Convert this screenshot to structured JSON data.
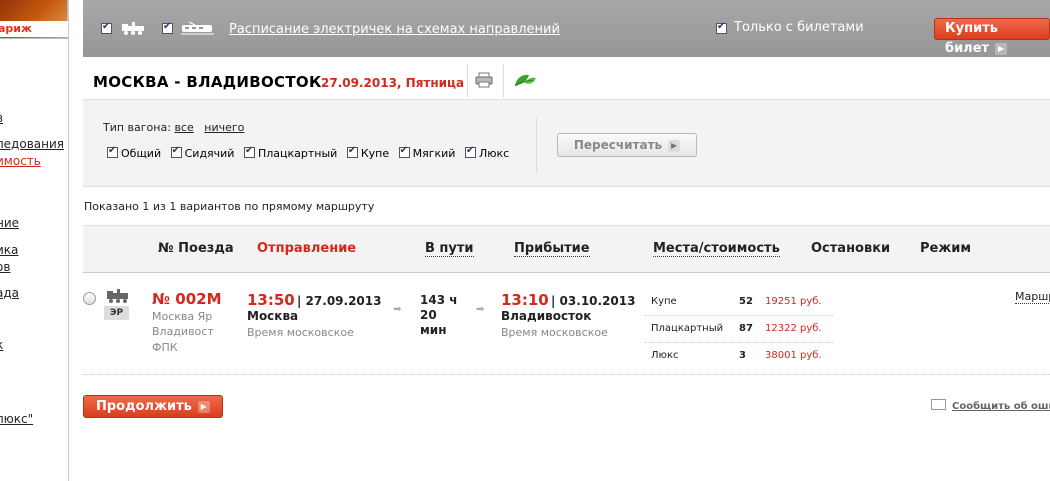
{
  "sidebar": {
    "logo_text": "ариж",
    "links": [
      "в",
      "ледования",
      "имость",
      "ние",
      "ика",
      "ов",
      "ада",
      "к",
      "люкс\""
    ]
  },
  "topbar": {
    "schedule_link": "Расписание электричек на схемах направлений",
    "only_tickets": "Только с билетами",
    "buy_ticket": "Купить билет"
  },
  "route": {
    "title": "МОСКВА - ВЛАДИВОСТОК",
    "date": "27.09.2013, Пятница"
  },
  "filter": {
    "label": "Тип вагона:",
    "all": "все",
    "none": "ничего",
    "wagons": [
      "Общий",
      "Сидячий",
      "Плацкартный",
      "Купе",
      "Мягкий",
      "Люкс"
    ],
    "recalc": "Пересчитать"
  },
  "shown_text": "Показано 1 из 1 вариантов по прямому маршруту",
  "table": {
    "headers": {
      "train_no": "№ Поезда",
      "departure": "Отправление",
      "duration": "В пути",
      "arrival": "Прибытие",
      "seats": "Места/стоимость",
      "stops": "Остановки",
      "mode": "Режим"
    },
    "row": {
      "badge": "ЭР",
      "number": "№ 002М",
      "sub1": "Москва Яр",
      "sub2": "Владивост",
      "sub3": "ФПК",
      "dep_time": "13:50",
      "dep_date": "| 27.09.2013",
      "dep_city": "Москва",
      "dep_tz": "Время московское",
      "dur1": "143 ч",
      "dur2": "20",
      "dur3": "мин",
      "arr_time": "13:10",
      "arr_date": "| 03.10.2013",
      "arr_city": "Владивосток",
      "arr_tz": "Время московское",
      "seats": [
        {
          "name": "Купе",
          "count": "52",
          "price": "19251 руб."
        },
        {
          "name": "Плацкартный",
          "count": "87",
          "price": "12322 руб."
        },
        {
          "name": "Люкс",
          "count": "3",
          "price": "38001 руб."
        }
      ],
      "route_link": "Маршр"
    }
  },
  "continue_button": "Продолжить",
  "report_link": "Сообщить об оши",
  "colors": {
    "accent": "#d5271b",
    "topbar": "#9e9e9e"
  }
}
